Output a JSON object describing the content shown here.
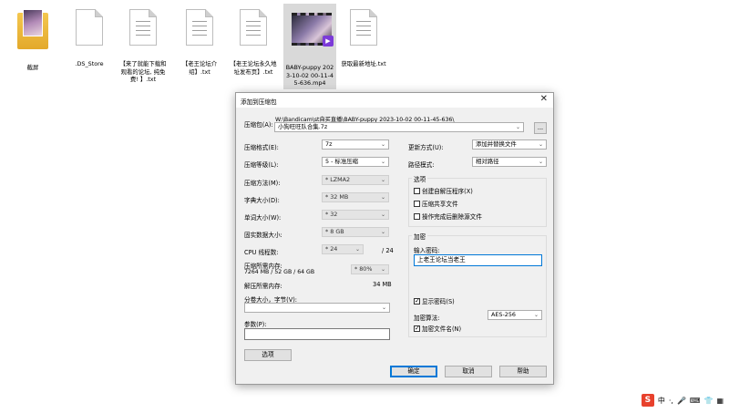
{
  "desktop": {
    "files": [
      {
        "label": "截屏"
      },
      {
        "label": ".DS_Store"
      },
      {
        "label": "【来了就能下载和观看的论坛, 纯免费! 】.txt"
      },
      {
        "label": "【老王论坛介绍】.txt"
      },
      {
        "label": "【老王论坛永久地址发布页】.txt"
      },
      {
        "label": "BABY-puppy 2023-10-02 00-11-45-636.mp4"
      },
      {
        "label": "获取最新地址.txt"
      }
    ]
  },
  "dialog": {
    "title": "添加到压缩包",
    "archive_label": "压缩包(A):",
    "archive_path": "W:\\Bandicam\\st自买直播\\BABY-puppy 2023-10-02 00-11-45-636\\",
    "archive_name": "小狗旺旺队合集.7z",
    "browse": "...",
    "left": {
      "format_label": "压缩格式(E):",
      "format_value": "7z",
      "level_label": "压缩等级(L):",
      "level_value": "5 - 标准压缩",
      "method_label": "压缩方法(M):",
      "method_value": "* LZMA2",
      "dict_label": "字典大小(D):",
      "dict_value": "* 32 MB",
      "word_label": "单词大小(W):",
      "word_value": "* 32",
      "solid_label": "固实数据大小:",
      "solid_value": "* 8 GB",
      "cpu_label": "CPU 线程数:",
      "cpu_value": "* 24",
      "cpu_max": "/ 24",
      "mem_label": "压缩所需内存:",
      "mem_detail": "7264 MB / 52 GB / 64 GB",
      "mem_value": "* 80%",
      "decomp_label": "解压所需内存:",
      "decomp_value": "34 MB",
      "split_label": "分卷大小，字节(V):",
      "params_label": "参数(P):",
      "options_button": "选项"
    },
    "right": {
      "update_label": "更新方式(U):",
      "update_value": "添加并替换文件",
      "path_label": "路径模式:",
      "path_value": "相对路径",
      "options_title": "选项",
      "opt_sfx": "创建自解压程序(X)",
      "opt_shared": "压缩共享文件",
      "opt_delete": "操作完成后删除源文件",
      "encrypt_title": "加密",
      "password_label": "输入密码:",
      "password_value": "上老王论坛当老王",
      "show_password": "显示密码(S)",
      "method_label": "加密算法:",
      "method_value": "AES-256",
      "encrypt_names": "加密文件名(N)"
    },
    "buttons": {
      "ok": "确定",
      "cancel": "取消",
      "help": "帮助"
    }
  },
  "tray": {
    "ime": "中",
    "s": "S"
  }
}
